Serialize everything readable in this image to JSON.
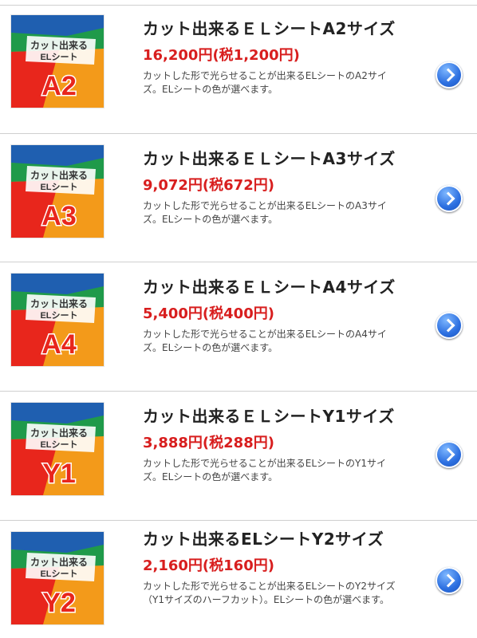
{
  "items": [
    {
      "title": "カット出来るＥＬシートA2サイズ",
      "price": "16,200円(税1,200円)",
      "description": "カットした形で光らせることが出来るELシートのA2サイズ。ELシートの色が選べます。",
      "thumb_label": "カット出来る",
      "thumb_sub": "ELシート",
      "thumb_code": "A2"
    },
    {
      "title": "カット出来るＥＬシートA3サイズ",
      "price": "9,072円(税672円)",
      "description": "カットした形で光らせることが出来るELシートのA3サイズ。ELシートの色が選べます。",
      "thumb_label": "カット出来る",
      "thumb_sub": "ELシート",
      "thumb_code": "A3"
    },
    {
      "title": "カット出来るＥＬシートA4サイズ",
      "price": "5,400円(税400円)",
      "description": "カットした形で光らせることが出来るELシートのA4サイズ。ELシートの色が選べます。",
      "thumb_label": "カット出来る",
      "thumb_sub": "ELシート",
      "thumb_code": "A4"
    },
    {
      "title": "カット出来るＥＬシートY1サイズ",
      "price": "3,888円(税288円)",
      "description": "カットした形で光らせることが出来るELシートのY1サイズ。ELシートの色が選べます。",
      "thumb_label": "カット出来る",
      "thumb_sub": "ELシート",
      "thumb_code": "Y1"
    },
    {
      "title": "カット出来るELシートY2サイズ",
      "price": "2,160円(税160円)",
      "description": "カットした形で光らせることが出来るELシートのY2サイズ（Y1サイズのハーフカット）。ELシートの色が選べます。",
      "thumb_label": "カット出来る",
      "thumb_sub": "ELシート",
      "thumb_code": "Y2"
    }
  ],
  "colors": {
    "price": "#d81e1e",
    "chevron": "#2c6fe0",
    "thumb_red": "#e8261c",
    "thumb_orange": "#f39a1a",
    "thumb_green": "#1f9a4a",
    "thumb_blue": "#1f5fb0"
  },
  "icons": {
    "row_action": "chevron-right-circle-icon"
  }
}
